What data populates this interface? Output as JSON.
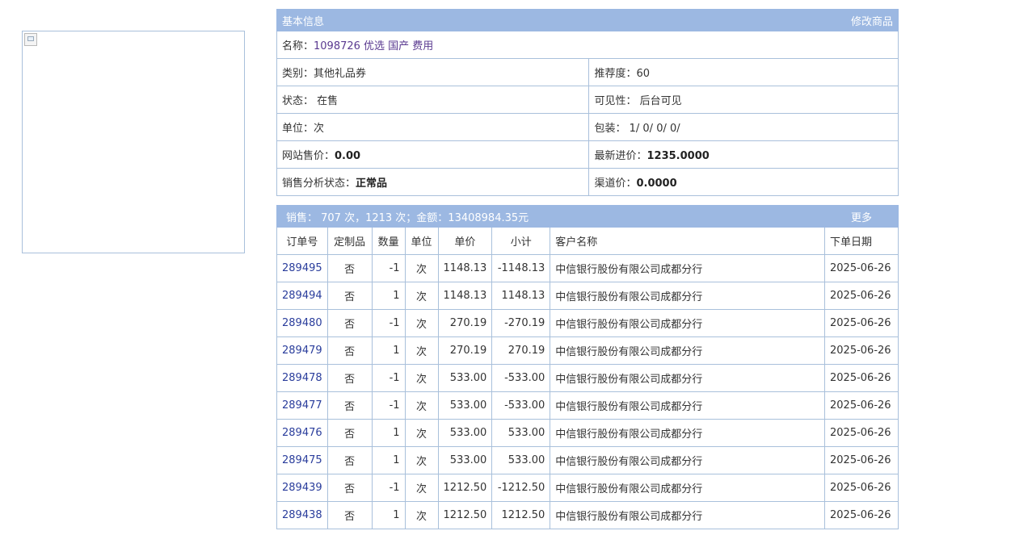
{
  "basic": {
    "header": "基本信息",
    "edit_link": "修改商品",
    "name_label": "名称：",
    "name_value": "1098726 优选 国产 费用",
    "category_label": "类别：",
    "category_value": "其他礼品券",
    "recommend_label": "推荐度：",
    "recommend_value": "60",
    "status_label": "状态：",
    "status_value": "在售",
    "visibility_label": "可见性：",
    "visibility_value": "后台可见",
    "unit_label": "单位：",
    "unit_value": "次",
    "package_label": "包装：",
    "package_value": "1/ 0/ 0/ 0/",
    "site_price_label": "网站售价：",
    "site_price_value": "0.00",
    "latest_cost_label": "最新进价：",
    "latest_cost_value": "1235.0000",
    "sales_status_label": "销售分析状态：",
    "sales_status_value": "正常品",
    "channel_price_label": "渠道价：",
    "channel_price_value": "0.0000"
  },
  "sales": {
    "summary": "销售： 707 次，1213 次；金额：13408984.35元",
    "more_link": "更多",
    "columns": [
      "订单号",
      "定制品",
      "数量",
      "单位",
      "单价",
      "小计",
      "客户名称",
      "下单日期"
    ],
    "rows": [
      {
        "order": "289495",
        "custom": "否",
        "qty": "-1",
        "unit": "次",
        "price": "1148.13",
        "subtotal": "-1148.13",
        "customer": "中信银行股份有限公司成都分行",
        "date": "2025-06-26"
      },
      {
        "order": "289494",
        "custom": "否",
        "qty": "1",
        "unit": "次",
        "price": "1148.13",
        "subtotal": "1148.13",
        "customer": "中信银行股份有限公司成都分行",
        "date": "2025-06-26"
      },
      {
        "order": "289480",
        "custom": "否",
        "qty": "-1",
        "unit": "次",
        "price": "270.19",
        "subtotal": "-270.19",
        "customer": "中信银行股份有限公司成都分行",
        "date": "2025-06-26"
      },
      {
        "order": "289479",
        "custom": "否",
        "qty": "1",
        "unit": "次",
        "price": "270.19",
        "subtotal": "270.19",
        "customer": "中信银行股份有限公司成都分行",
        "date": "2025-06-26"
      },
      {
        "order": "289478",
        "custom": "否",
        "qty": "-1",
        "unit": "次",
        "price": "533.00",
        "subtotal": "-533.00",
        "customer": "中信银行股份有限公司成都分行",
        "date": "2025-06-26"
      },
      {
        "order": "289477",
        "custom": "否",
        "qty": "-1",
        "unit": "次",
        "price": "533.00",
        "subtotal": "-533.00",
        "customer": "中信银行股份有限公司成都分行",
        "date": "2025-06-26"
      },
      {
        "order": "289476",
        "custom": "否",
        "qty": "1",
        "unit": "次",
        "price": "533.00",
        "subtotal": "533.00",
        "customer": "中信银行股份有限公司成都分行",
        "date": "2025-06-26"
      },
      {
        "order": "289475",
        "custom": "否",
        "qty": "1",
        "unit": "次",
        "price": "533.00",
        "subtotal": "533.00",
        "customer": "中信银行股份有限公司成都分行",
        "date": "2025-06-26"
      },
      {
        "order": "289439",
        "custom": "否",
        "qty": "-1",
        "unit": "次",
        "price": "1212.50",
        "subtotal": "-1212.50",
        "customer": "中信银行股份有限公司成都分行",
        "date": "2025-06-26"
      },
      {
        "order": "289438",
        "custom": "否",
        "qty": "1",
        "unit": "次",
        "price": "1212.50",
        "subtotal": "1212.50",
        "customer": "中信银行股份有限公司成都分行",
        "date": "2025-06-26"
      }
    ]
  },
  "colors": {
    "header_bg": "#9cb8e2",
    "border": "#a9c0db",
    "order_link": "#2a3d9c",
    "name_value": "#5a3a90"
  }
}
